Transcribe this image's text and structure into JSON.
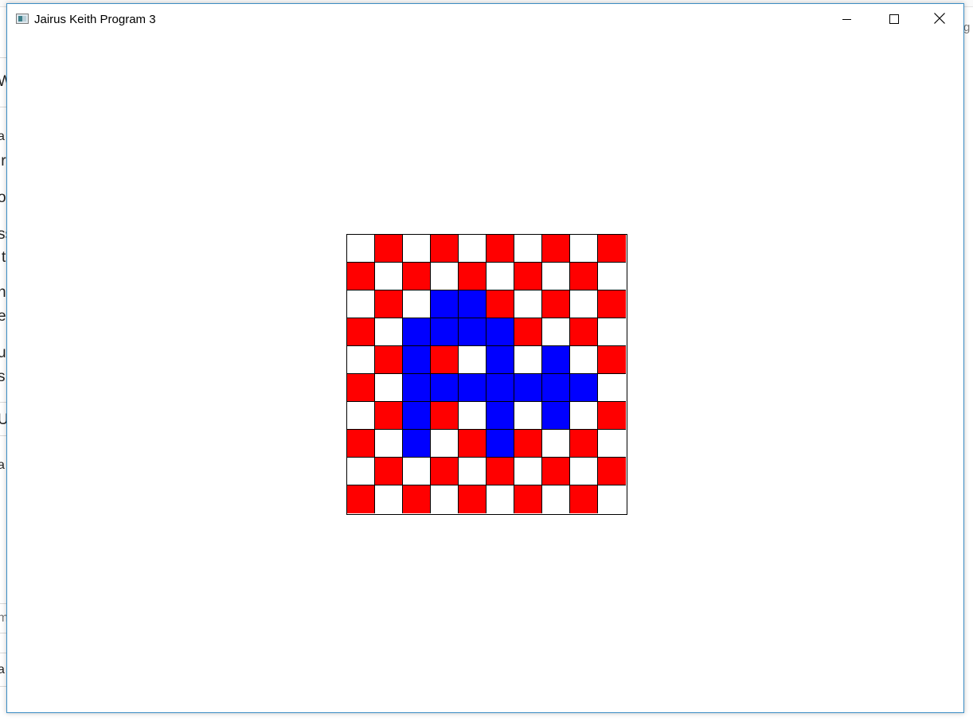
{
  "window": {
    "title": "Jairus Keith Program 3",
    "controls": {
      "minimize": "minimize-icon",
      "maximize": "maximize-icon",
      "close": "close-icon"
    }
  },
  "background_fragments": [
    "W",
    "a",
    "ir",
    "o",
    "ss",
    "t",
    "n",
    "e",
    "u",
    "s.",
    "U",
    "a",
    "m",
    "a"
  ],
  "background_right_fragment": "g",
  "colors": {
    "W": "#ffffff",
    "R": "#ff0000",
    "B": "#0000ff",
    "grid_line": "#000000",
    "window_border": "#3c8dc4"
  },
  "board": {
    "rows": [
      [
        "W",
        "R",
        "W",
        "R",
        "W",
        "R",
        "W",
        "R",
        "W",
        "R"
      ],
      [
        "R",
        "W",
        "R",
        "W",
        "R",
        "W",
        "R",
        "W",
        "R",
        "W"
      ],
      [
        "W",
        "R",
        "W",
        "B",
        "B",
        "R",
        "W",
        "R",
        "W",
        "R"
      ],
      [
        "R",
        "W",
        "B",
        "B",
        "B",
        "B",
        "R",
        "W",
        "R",
        "W"
      ],
      [
        "W",
        "R",
        "B",
        "R",
        "W",
        "B",
        "W",
        "B",
        "W",
        "R"
      ],
      [
        "R",
        "W",
        "B",
        "B",
        "B",
        "B",
        "B",
        "B",
        "B",
        "W"
      ],
      [
        "W",
        "R",
        "B",
        "R",
        "W",
        "B",
        "W",
        "B",
        "W",
        "R"
      ],
      [
        "R",
        "W",
        "B",
        "W",
        "R",
        "B",
        "R",
        "W",
        "R",
        "W"
      ],
      [
        "W",
        "R",
        "W",
        "R",
        "W",
        "R",
        "W",
        "R",
        "W",
        "R"
      ],
      [
        "R",
        "W",
        "R",
        "W",
        "R",
        "W",
        "R",
        "W",
        "R",
        "W"
      ]
    ]
  }
}
